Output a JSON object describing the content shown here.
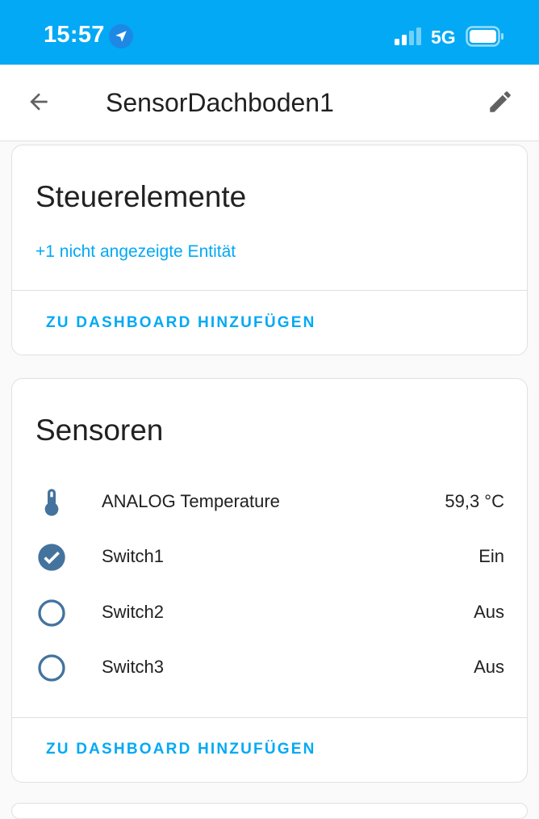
{
  "status_bar": {
    "time": "15:57",
    "network": "5G",
    "background_color": "#03a9f4"
  },
  "app_bar": {
    "title": "SensorDachboden1",
    "back_icon": "arrow-left-icon",
    "edit_icon": "pencil-icon"
  },
  "controls_card": {
    "title": "Steuerelemente",
    "hidden_entities_link": "+1 nicht angezeigte Entität",
    "action_label": "ZU DASHBOARD HINZUFÜGEN"
  },
  "sensors_card": {
    "title": "Sensoren",
    "rows": [
      {
        "icon": "thermometer-icon",
        "name": "ANALOG Temperature",
        "value": "59,3 °C"
      },
      {
        "icon": "checkbox-marked-circle-icon",
        "name": "Switch1",
        "value": "Ein"
      },
      {
        "icon": "checkbox-blank-circle-outline-icon",
        "name": "Switch2",
        "value": "Aus"
      },
      {
        "icon": "checkbox-blank-circle-outline-icon",
        "name": "Switch3",
        "value": "Aus"
      }
    ],
    "action_label": "ZU DASHBOARD HINZUFÜGEN"
  },
  "colors": {
    "accent": "#03a9f4",
    "icon": "#44739e",
    "text": "#212121"
  }
}
